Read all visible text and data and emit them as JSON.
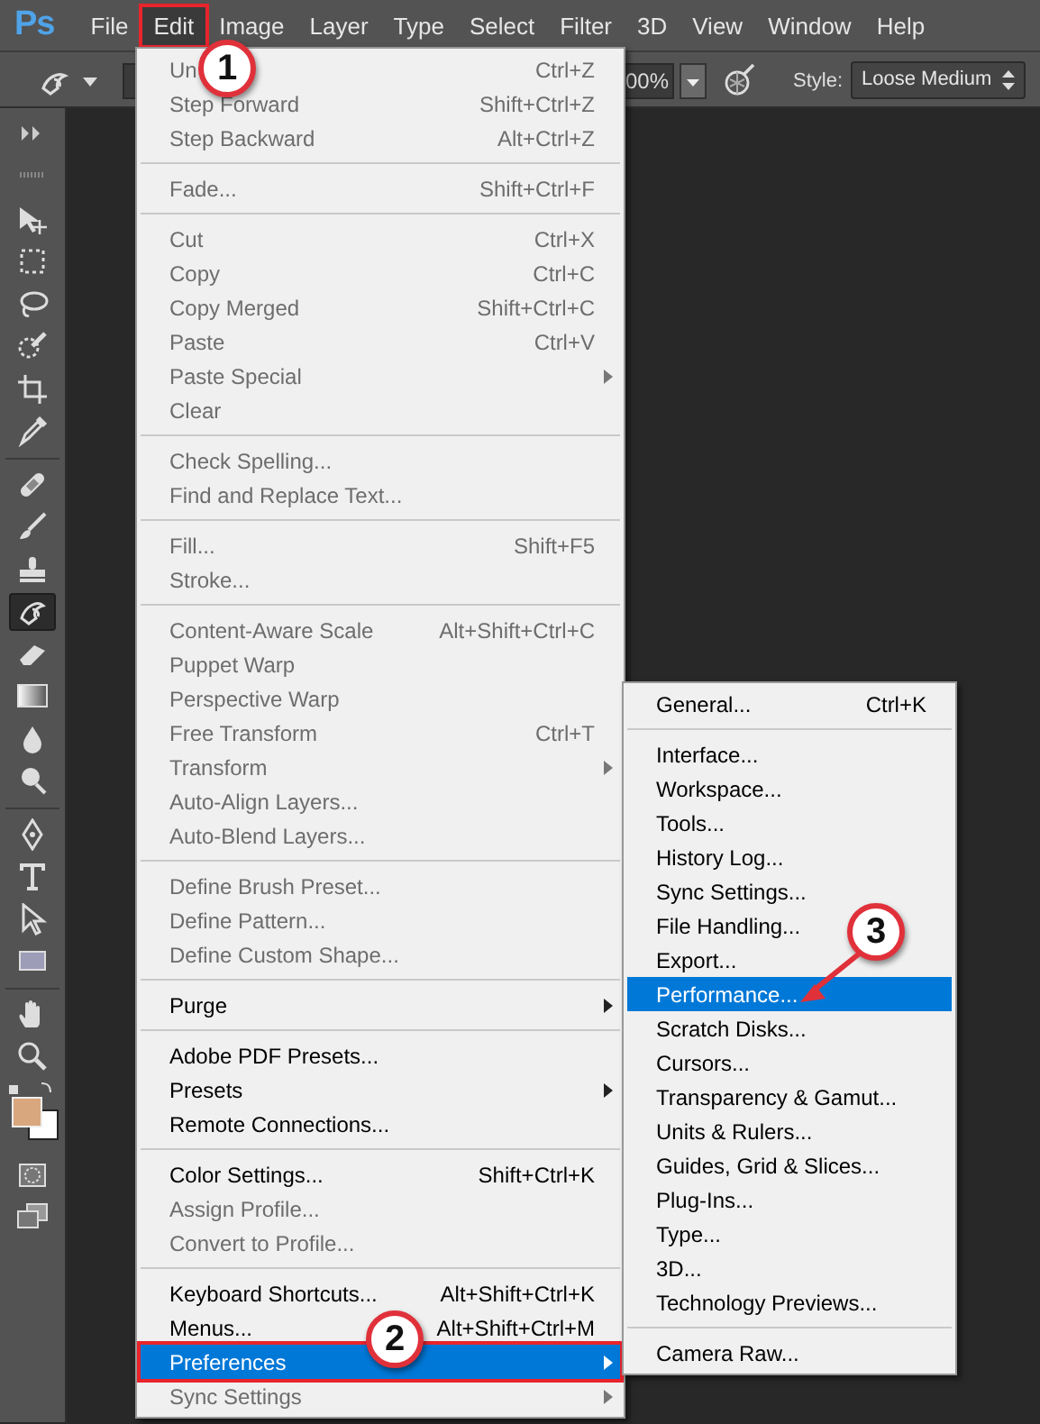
{
  "app": {
    "logo": "Ps"
  },
  "menubar": [
    {
      "label": "File",
      "selected": false,
      "boxed": false
    },
    {
      "label": "Edit",
      "selected": true,
      "boxed": true
    },
    {
      "label": "Image",
      "selected": false,
      "boxed": false
    },
    {
      "label": "Layer",
      "selected": false,
      "boxed": false
    },
    {
      "label": "Type",
      "selected": false,
      "boxed": false
    },
    {
      "label": "Select",
      "selected": false,
      "boxed": false
    },
    {
      "label": "Filter",
      "selected": false,
      "boxed": false
    },
    {
      "label": "3D",
      "selected": false,
      "boxed": false
    },
    {
      "label": "View",
      "selected": false,
      "boxed": false
    },
    {
      "label": "Window",
      "selected": false,
      "boxed": false
    },
    {
      "label": "Help",
      "selected": false,
      "boxed": false
    }
  ],
  "options_bar": {
    "opacity": "00%",
    "style_label": "Style:",
    "style_value": "Loose Medium"
  },
  "edit_menu": [
    {
      "kind": "item",
      "label": "Un",
      "shortcut": "Ctrl+Z",
      "disabled": true,
      "selected": false
    },
    {
      "kind": "item",
      "label": "Step Forward",
      "shortcut": "Shift+Ctrl+Z",
      "disabled": true,
      "selected": false
    },
    {
      "kind": "item",
      "label": "Step Backward",
      "shortcut": "Alt+Ctrl+Z",
      "disabled": true,
      "selected": false
    },
    {
      "kind": "separator"
    },
    {
      "kind": "item",
      "label": "Fade...",
      "shortcut": "Shift+Ctrl+F",
      "disabled": true,
      "selected": false
    },
    {
      "kind": "separator"
    },
    {
      "kind": "item",
      "label": "Cut",
      "shortcut": "Ctrl+X",
      "disabled": true,
      "selected": false
    },
    {
      "kind": "item",
      "label": "Copy",
      "shortcut": "Ctrl+C",
      "disabled": true,
      "selected": false
    },
    {
      "kind": "item",
      "label": "Copy Merged",
      "shortcut": "Shift+Ctrl+C",
      "disabled": true,
      "selected": false
    },
    {
      "kind": "item",
      "label": "Paste",
      "shortcut": "Ctrl+V",
      "disabled": true,
      "selected": false
    },
    {
      "kind": "item",
      "label": "Paste Special",
      "disabled": true,
      "submenu": true,
      "selected": false
    },
    {
      "kind": "item",
      "label": "Clear",
      "disabled": true,
      "selected": false
    },
    {
      "kind": "separator"
    },
    {
      "kind": "item",
      "label": "Check Spelling...",
      "disabled": true,
      "selected": false
    },
    {
      "kind": "item",
      "label": "Find and Replace Text...",
      "disabled": true,
      "selected": false
    },
    {
      "kind": "separator"
    },
    {
      "kind": "item",
      "label": "Fill...",
      "shortcut": "Shift+F5",
      "disabled": true,
      "selected": false
    },
    {
      "kind": "item",
      "label": "Stroke...",
      "disabled": true,
      "selected": false
    },
    {
      "kind": "separator"
    },
    {
      "kind": "item",
      "label": "Content-Aware Scale",
      "shortcut": "Alt+Shift+Ctrl+C",
      "disabled": true,
      "selected": false
    },
    {
      "kind": "item",
      "label": "Puppet Warp",
      "disabled": true,
      "selected": false
    },
    {
      "kind": "item",
      "label": "Perspective Warp",
      "disabled": true,
      "selected": false
    },
    {
      "kind": "item",
      "label": "Free Transform",
      "shortcut": "Ctrl+T",
      "disabled": true,
      "selected": false
    },
    {
      "kind": "item",
      "label": "Transform",
      "disabled": true,
      "submenu": true,
      "selected": false
    },
    {
      "kind": "item",
      "label": "Auto-Align Layers...",
      "disabled": true,
      "selected": false
    },
    {
      "kind": "item",
      "label": "Auto-Blend Layers...",
      "disabled": true,
      "selected": false
    },
    {
      "kind": "separator"
    },
    {
      "kind": "item",
      "label": "Define Brush Preset...",
      "disabled": true,
      "selected": false
    },
    {
      "kind": "item",
      "label": "Define Pattern...",
      "disabled": true,
      "selected": false
    },
    {
      "kind": "item",
      "label": "Define Custom Shape...",
      "disabled": true,
      "selected": false
    },
    {
      "kind": "separator"
    },
    {
      "kind": "item",
      "label": "Purge",
      "disabled": false,
      "submenu": true,
      "selected": false
    },
    {
      "kind": "separator"
    },
    {
      "kind": "item",
      "label": "Adobe PDF Presets...",
      "disabled": false,
      "selected": false
    },
    {
      "kind": "item",
      "label": "Presets",
      "disabled": false,
      "submenu": true,
      "selected": false
    },
    {
      "kind": "item",
      "label": "Remote Connections...",
      "disabled": false,
      "selected": false
    },
    {
      "kind": "separator"
    },
    {
      "kind": "item",
      "label": "Color Settings...",
      "shortcut": "Shift+Ctrl+K",
      "disabled": false,
      "selected": false
    },
    {
      "kind": "item",
      "label": "Assign Profile...",
      "disabled": true,
      "selected": false
    },
    {
      "kind": "item",
      "label": "Convert to Profile...",
      "disabled": true,
      "selected": false
    },
    {
      "kind": "separator"
    },
    {
      "kind": "item",
      "label": "Keyboard Shortcuts...",
      "shortcut": "Alt+Shift+Ctrl+K",
      "disabled": false,
      "selected": false
    },
    {
      "kind": "item",
      "label": "Menus...",
      "shortcut": "Alt+Shift+Ctrl+M",
      "disabled": false,
      "selected": false
    },
    {
      "kind": "item",
      "label": "Preferences",
      "disabled": false,
      "submenu": true,
      "selected": true,
      "boxed": true
    },
    {
      "kind": "item",
      "label": "Sync Settings",
      "disabled": true,
      "submenu": true,
      "selected": false
    }
  ],
  "preferences_menu": [
    {
      "kind": "item",
      "label": "General...",
      "shortcut": "Ctrl+K",
      "selected": false
    },
    {
      "kind": "separator"
    },
    {
      "kind": "item",
      "label": "Interface...",
      "selected": false
    },
    {
      "kind": "item",
      "label": "Workspace...",
      "selected": false
    },
    {
      "kind": "item",
      "label": "Tools...",
      "selected": false
    },
    {
      "kind": "item",
      "label": "History Log...",
      "selected": false
    },
    {
      "kind": "item",
      "label": "Sync Settings...",
      "selected": false
    },
    {
      "kind": "item",
      "label": "File Handling...",
      "selected": false
    },
    {
      "kind": "item",
      "label": "Export...",
      "selected": false
    },
    {
      "kind": "item",
      "label": "Performance...",
      "selected": true
    },
    {
      "kind": "item",
      "label": "Scratch Disks...",
      "selected": false
    },
    {
      "kind": "item",
      "label": "Cursors...",
      "selected": false
    },
    {
      "kind": "item",
      "label": "Transparency & Gamut...",
      "selected": false
    },
    {
      "kind": "item",
      "label": "Units & Rulers...",
      "selected": false
    },
    {
      "kind": "item",
      "label": "Guides, Grid & Slices...",
      "selected": false
    },
    {
      "kind": "item",
      "label": "Plug-Ins...",
      "selected": false
    },
    {
      "kind": "item",
      "label": "Type...",
      "selected": false
    },
    {
      "kind": "item",
      "label": "3D...",
      "selected": false
    },
    {
      "kind": "item",
      "label": "Technology Previews...",
      "selected": false
    },
    {
      "kind": "separator"
    },
    {
      "kind": "item",
      "label": "Camera Raw...",
      "selected": false
    }
  ],
  "callouts": [
    "1",
    "2",
    "3"
  ]
}
